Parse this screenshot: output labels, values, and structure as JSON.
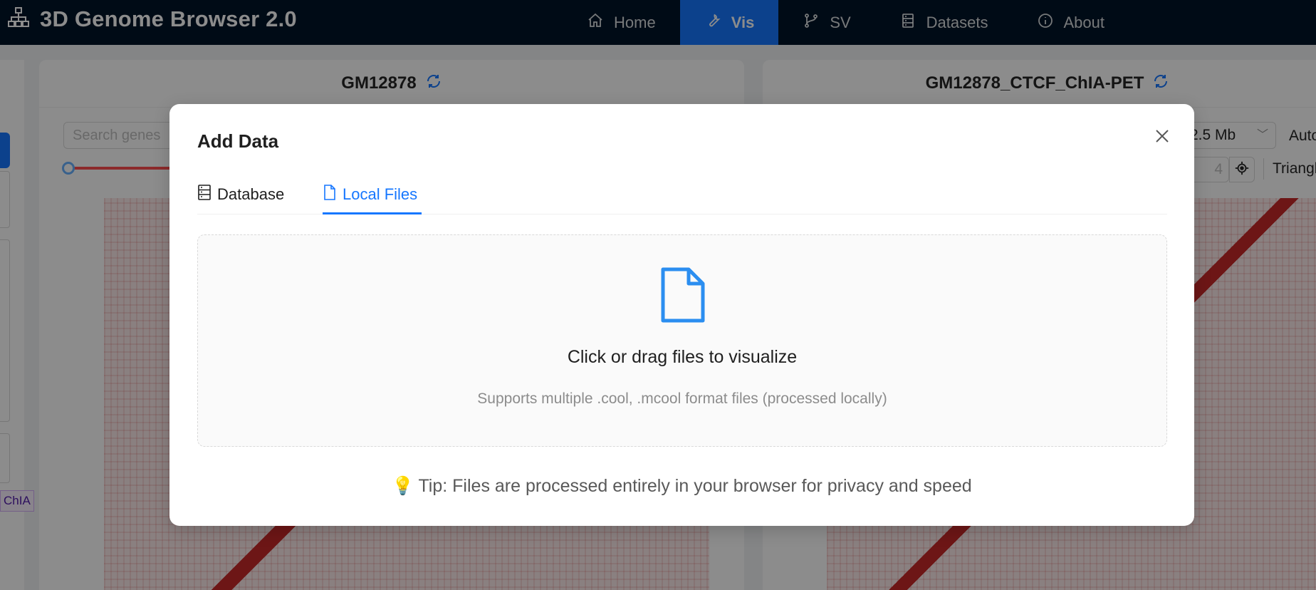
{
  "navbar": {
    "title": "3D Genome Browser 2.0",
    "logo_icon": "sitemap-icon",
    "items": [
      {
        "label": "Home",
        "icon": "home-icon",
        "active": false
      },
      {
        "label": "Vis",
        "icon": "wrench-icon",
        "active": true
      },
      {
        "label": "SV",
        "icon": "branch-icon",
        "active": false
      },
      {
        "label": "Datasets",
        "icon": "database-icon",
        "active": false
      },
      {
        "label": "About",
        "icon": "info-icon",
        "active": false
      }
    ]
  },
  "background": {
    "left_panel": {
      "title": "GM12878",
      "search_placeholder": "Search genes"
    },
    "right_panel": {
      "title": "GM12878_CTCF_ChIA-PET",
      "resolution": "2.5 Mb",
      "mode": "Auto",
      "step_value": "4",
      "view": "Triangle"
    },
    "rail_tag": "ChIA"
  },
  "modal": {
    "title": "Add Data",
    "tabs": [
      {
        "label": "Database",
        "icon": "database-icon",
        "active": false
      },
      {
        "label": "Local Files",
        "icon": "file-icon",
        "active": true
      }
    ],
    "dropzone": {
      "icon": "file-icon",
      "text": "Click or drag files to visualize",
      "hint": "Supports multiple .cool, .mcool format files (processed locally)"
    },
    "tip": "Tip: Files are processed entirely in your browser for privacy and speed",
    "tip_icon": "💡"
  },
  "colors": {
    "primary": "#1677ff",
    "navbar_bg": "#001529",
    "heatmap_red": "#c62828"
  }
}
